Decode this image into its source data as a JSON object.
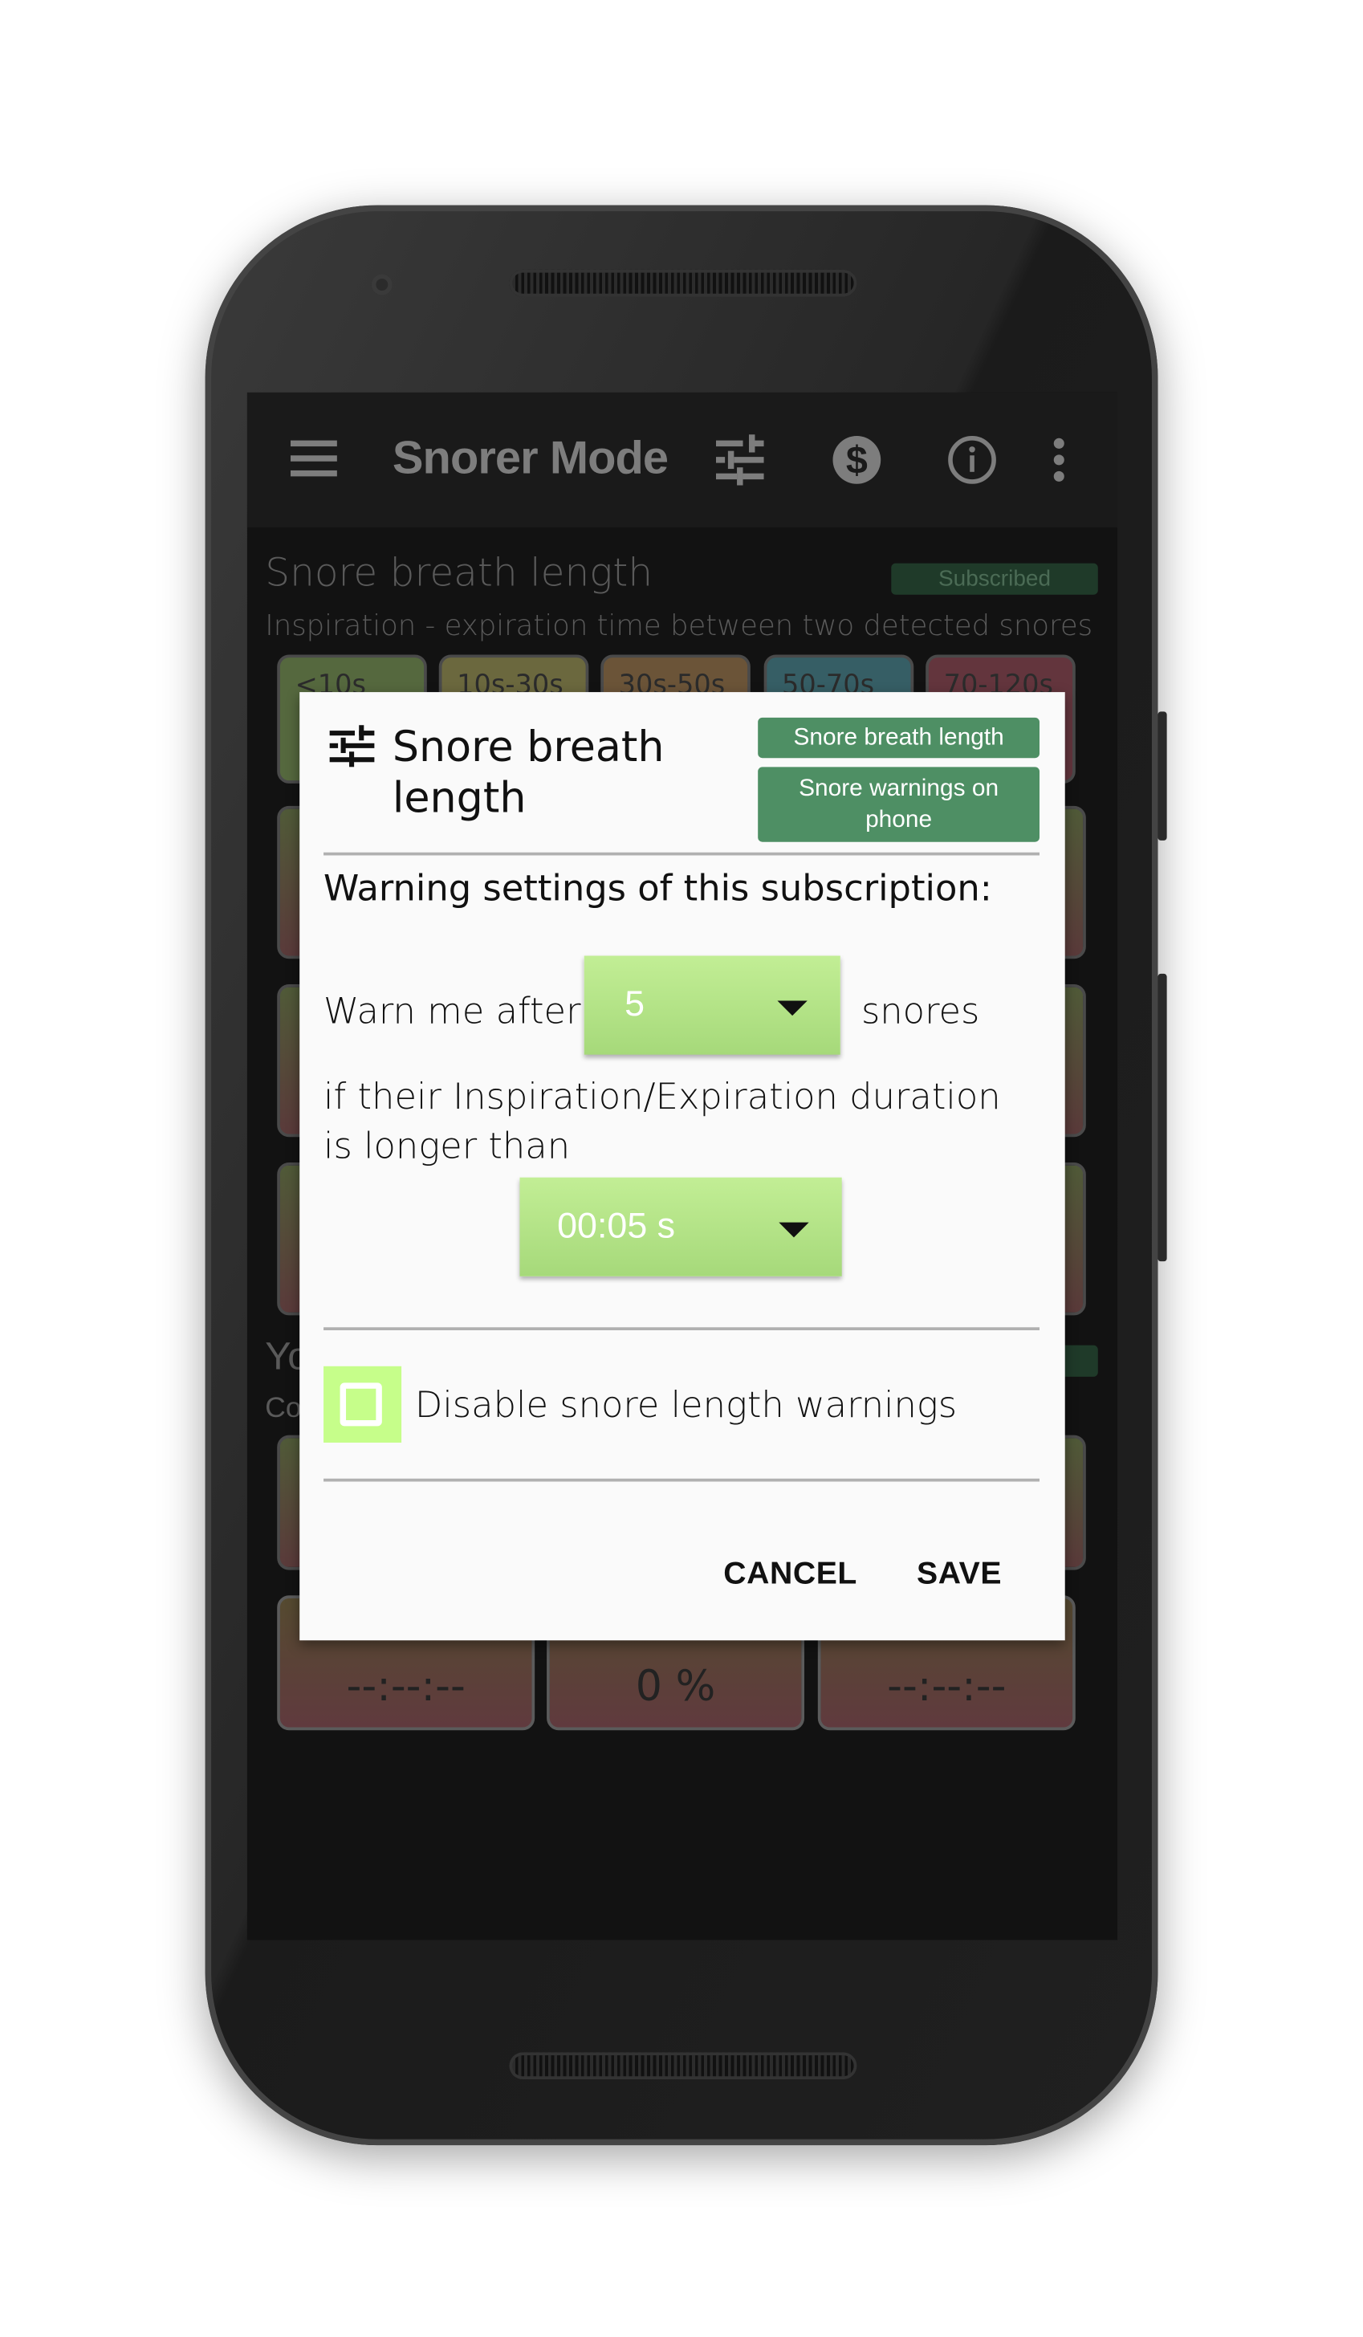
{
  "toolbar": {
    "title": "Snorer Mode",
    "icons": [
      "menu-icon",
      "sliders-icon",
      "dollar-icon",
      "info-icon",
      "more-vert-icon"
    ]
  },
  "background": {
    "section_title": "Snore breath length",
    "badge": "Subscribed",
    "subtitle": "Inspiration - expiration time between two detected snores",
    "tags": [
      "<10s",
      "10s-30s",
      "30s-50s",
      "50-70s",
      "70-120s"
    ],
    "partial_title": "Yo",
    "partial_subtitle": "Co",
    "bottom_values": [
      "--:--:--",
      "0 %",
      "--:--:--"
    ]
  },
  "dialog": {
    "title": "Snore breath length",
    "chip1": "Snore breath length",
    "chip2": "Snore warnings on phone",
    "heading": "Warning settings of this subscription:",
    "warn_prefix": "Warn me after",
    "count_value": "5",
    "warn_suffix": "snores",
    "duration_text": "if their Inspiration/Expiration duration is longer than",
    "duration_value": "00:05 s",
    "checkbox_label": "Disable snore length warnings",
    "checkbox_checked": false,
    "cancel": "CANCEL",
    "save": "SAVE"
  },
  "colors": {
    "accent": "#4e8f64",
    "spinner": "#b5e58a",
    "checkbox": "#c6fe8a"
  }
}
